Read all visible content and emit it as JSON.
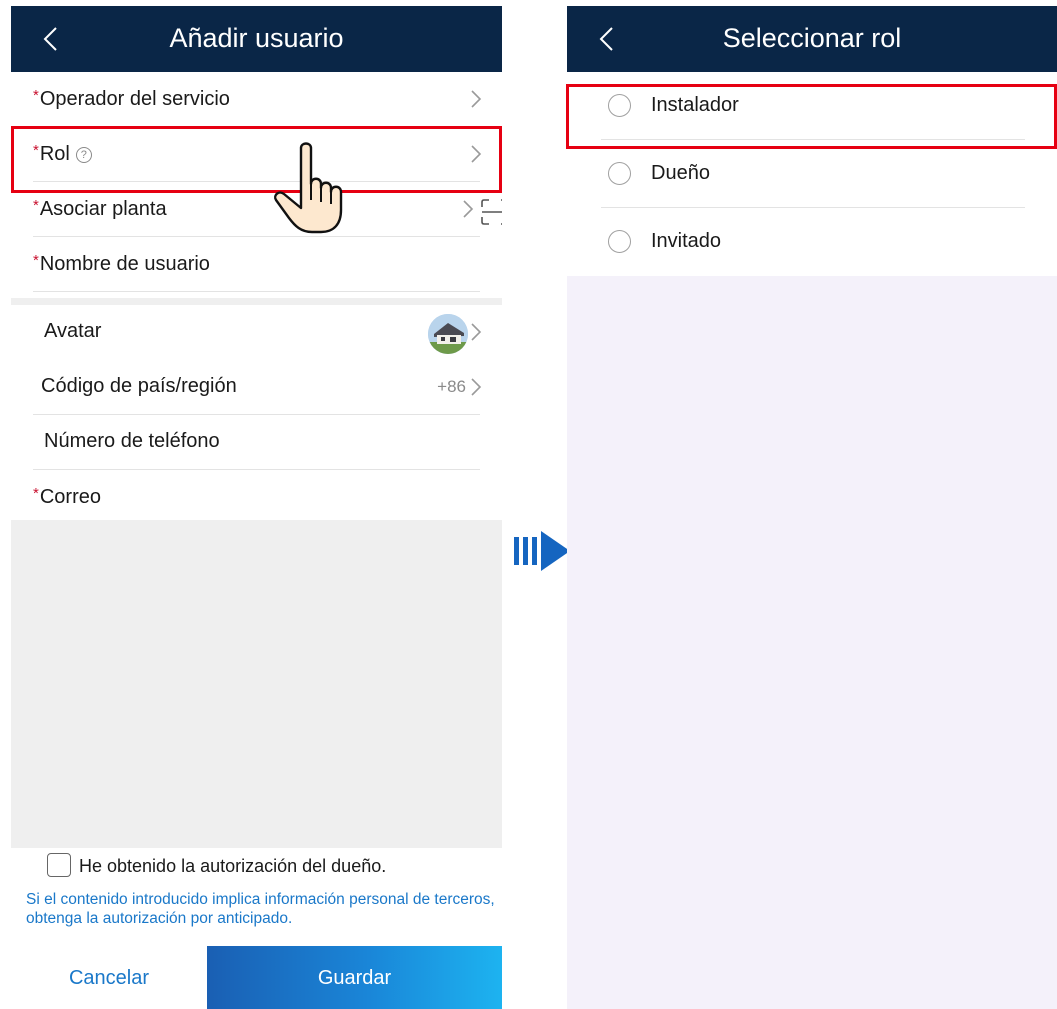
{
  "left_screen": {
    "header": {
      "title": "Añadir usuario"
    },
    "required_mark": "*",
    "fields_required": [
      {
        "label": "Operador del servicio"
      },
      {
        "label": "Rol",
        "help_glyph": "?"
      },
      {
        "label": "Asociar planta"
      },
      {
        "label": "Nombre de usuario"
      }
    ],
    "fields_optional": [
      {
        "label": "Avatar"
      },
      {
        "label": "Código de país/región",
        "value": "+86"
      },
      {
        "label": "Número de teléfono"
      },
      {
        "label": "Correo",
        "required": true
      }
    ],
    "authorization": {
      "checkbox_label": "He obtenido la autorización del dueño.",
      "checked": false,
      "note": "Si el contenido introducido implica información personal de terceros, obtenga la autorización por anticipado."
    },
    "footer": {
      "cancel_label": "Cancelar",
      "save_label": "Guardar"
    }
  },
  "right_screen": {
    "header": {
      "title": "Seleccionar rol"
    },
    "options": [
      {
        "label": "Instalador",
        "selected": false
      },
      {
        "label": "Dueño",
        "selected": false
      },
      {
        "label": "Invitado",
        "selected": false
      }
    ]
  },
  "colors": {
    "header_bg": "#0a2647",
    "highlight": "#e60012",
    "required": "#c8102e",
    "link": "#1a78c9",
    "arrow": "#1565c0"
  },
  "icons": [
    "back-chevron-icon",
    "chevron-right-icon",
    "help-icon",
    "scan-icon",
    "pointing-hand-icon",
    "flow-arrow-icon",
    "radio-icon",
    "checkbox-icon"
  ]
}
